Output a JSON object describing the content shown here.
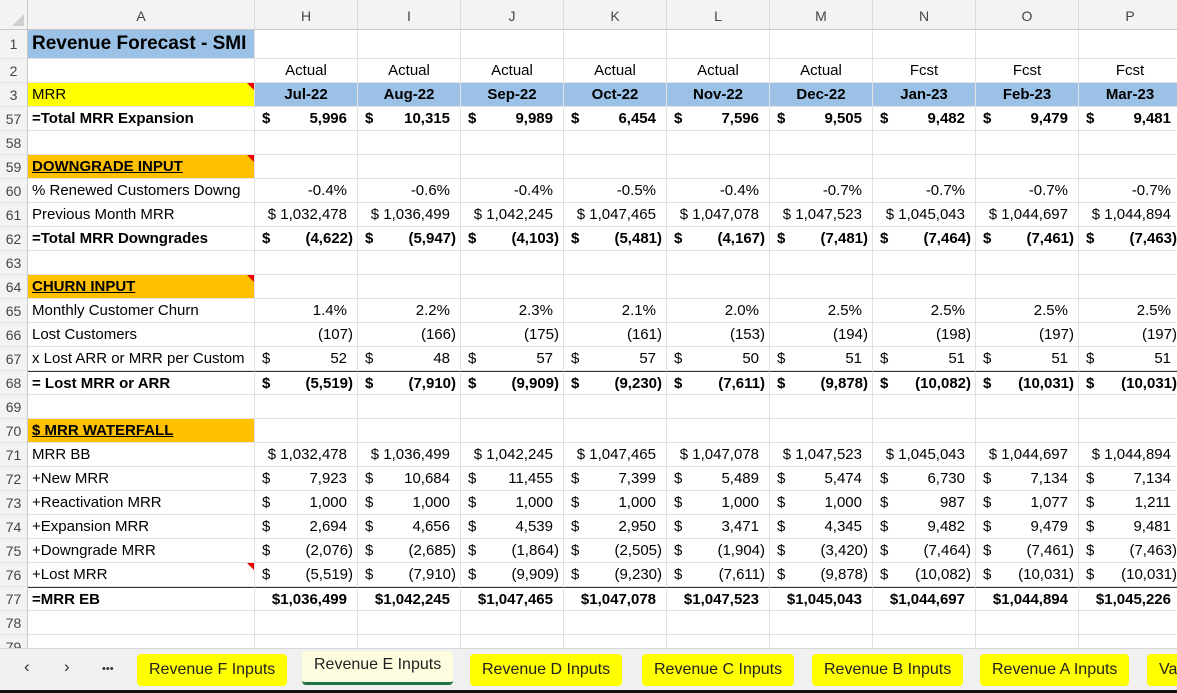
{
  "columns": [
    "A",
    "H",
    "I",
    "J",
    "K",
    "L",
    "M",
    "N",
    "O",
    "P"
  ],
  "title": "Revenue Forecast - SMI",
  "row2": [
    "Actual",
    "Actual",
    "Actual",
    "Actual",
    "Actual",
    "Actual",
    "Fcst",
    "Fcst",
    "Fcst"
  ],
  "row3_label": "MRR",
  "months": [
    "Jul-22",
    "Aug-22",
    "Sep-22",
    "Oct-22",
    "Nov-22",
    "Dec-22",
    "Jan-23",
    "Feb-23",
    "Mar-23"
  ],
  "rows": [
    {
      "num": "57",
      "label": "=Total MRR Expansion",
      "style": "bold",
      "cur": true,
      "values": [
        "5,996",
        "10,315",
        "9,989",
        "6,454",
        "7,596",
        "9,505",
        "9,482",
        "9,479",
        "9,481"
      ]
    },
    {
      "num": "58",
      "label": "",
      "values": []
    },
    {
      "num": "59",
      "label": "DOWNGRADE INPUT",
      "style": "section",
      "comment": true,
      "values": []
    },
    {
      "num": "60",
      "label": "% Renewed Customers Downg",
      "values": [
        "-0.4%",
        "-0.6%",
        "-0.4%",
        "-0.5%",
        "-0.4%",
        "-0.7%",
        "-0.7%",
        "-0.7%",
        "-0.7%"
      ]
    },
    {
      "num": "61",
      "label": "Previous Month MRR",
      "values": [
        "$ 1,032,478",
        "$ 1,036,499",
        "$ 1,042,245",
        "$ 1,047,465",
        "$ 1,047,078",
        "$ 1,047,523",
        "$ 1,045,043",
        "$ 1,044,697",
        "$ 1,044,894"
      ]
    },
    {
      "num": "62",
      "label": "=Total MRR Downgrades",
      "style": "bold",
      "cur": true,
      "values": [
        "(4,622)",
        "(5,947)",
        "(4,103)",
        "(5,481)",
        "(4,167)",
        "(7,481)",
        "(7,464)",
        "(7,461)",
        "(7,463)"
      ]
    },
    {
      "num": "63",
      "label": "",
      "values": []
    },
    {
      "num": "64",
      "label": "CHURN INPUT",
      "style": "section",
      "comment": true,
      "values": []
    },
    {
      "num": "65",
      "label": "Monthly Customer Churn",
      "values": [
        "1.4%",
        "2.2%",
        "2.3%",
        "2.1%",
        "2.0%",
        "2.5%",
        "2.5%",
        "2.5%",
        "2.5%"
      ]
    },
    {
      "num": "66",
      "label": "Lost Customers",
      "values": [
        "(107)",
        "(166)",
        "(175)",
        "(161)",
        "(153)",
        "(194)",
        "(198)",
        "(197)",
        "(197)"
      ]
    },
    {
      "num": "67",
      "label": "x Lost ARR or MRR per Custom",
      "cur": true,
      "values": [
        "52",
        "48",
        "57",
        "57",
        "50",
        "51",
        "51",
        "51",
        "51"
      ]
    },
    {
      "num": "68",
      "label": "= Lost MRR or ARR",
      "style": "bold",
      "cur": true,
      "topline": true,
      "values": [
        "(5,519)",
        "(7,910)",
        "(9,909)",
        "(9,230)",
        "(7,611)",
        "(9,878)",
        "(10,082)",
        "(10,031)",
        "(10,031)"
      ]
    },
    {
      "num": "69",
      "label": "",
      "values": []
    },
    {
      "num": "70",
      "label": "$ MRR WATERFALL",
      "style": "section",
      "values": []
    },
    {
      "num": "71",
      "label": "MRR BB",
      "values": [
        "$ 1,032,478",
        "$ 1,036,499",
        "$ 1,042,245",
        "$ 1,047,465",
        "$ 1,047,078",
        "$ 1,047,523",
        "$ 1,045,043",
        "$ 1,044,697",
        "$ 1,044,894"
      ]
    },
    {
      "num": "72",
      "label": "+New MRR",
      "cur": true,
      "values": [
        "7,923",
        "10,684",
        "11,455",
        "7,399",
        "5,489",
        "5,474",
        "6,730",
        "7,134",
        "7,134"
      ]
    },
    {
      "num": "73",
      "label": "+Reactivation MRR",
      "cur": true,
      "values": [
        "1,000",
        "1,000",
        "1,000",
        "1,000",
        "1,000",
        "1,000",
        "987",
        "1,077",
        "1,211"
      ]
    },
    {
      "num": "74",
      "label": "+Expansion MRR",
      "cur": true,
      "values": [
        "2,694",
        "4,656",
        "4,539",
        "2,950",
        "3,471",
        "4,345",
        "9,482",
        "9,479",
        "9,481"
      ]
    },
    {
      "num": "75",
      "label": "+Downgrade MRR",
      "cur": true,
      "values": [
        "(2,076)",
        "(2,685)",
        "(1,864)",
        "(2,505)",
        "(1,904)",
        "(3,420)",
        "(7,464)",
        "(7,461)",
        "(7,463)"
      ]
    },
    {
      "num": "76",
      "label": "+Lost MRR",
      "cur": true,
      "comment": true,
      "values": [
        "(5,519)",
        "(7,910)",
        "(9,909)",
        "(9,230)",
        "(7,611)",
        "(9,878)",
        "(10,082)",
        "(10,031)",
        "(10,031)"
      ]
    },
    {
      "num": "77",
      "label": "=MRR EB",
      "style": "bold",
      "topline": true,
      "values": [
        "$1,036,499",
        "$1,042,245",
        "$1,047,465",
        "$1,047,078",
        "$1,047,523",
        "$1,045,043",
        "$1,044,697",
        "$1,044,894",
        "$1,045,226"
      ]
    },
    {
      "num": "78",
      "label": "",
      "values": []
    },
    {
      "num": "79",
      "label": "",
      "values": []
    }
  ],
  "currency_symbol": "$",
  "tabs": {
    "prev": "‹",
    "next": "›",
    "more": "•••",
    "sheets": [
      "Revenue F Inputs",
      "Revenue E Inputs",
      "Revenue D Inputs",
      "Revenue C Inputs",
      "Revenue B Inputs",
      "Revenue A Inputs",
      "Va"
    ],
    "active_index": 1
  },
  "colors": {
    "section": "#ffc000",
    "header_blue": "#9bc2e6",
    "tab": "#ffff00",
    "active_underline": "#217346"
  }
}
